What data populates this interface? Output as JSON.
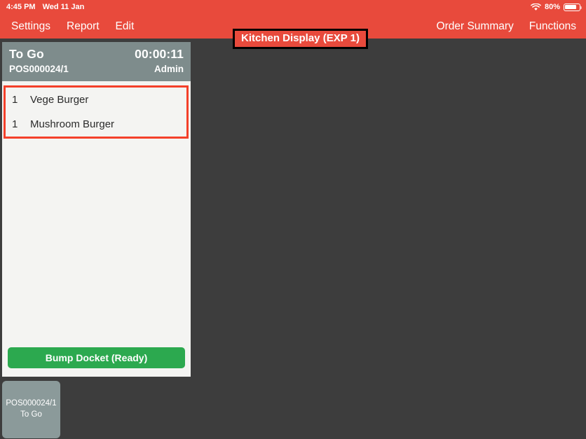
{
  "status_bar": {
    "time": "4:45 PM",
    "date": "Wed 11 Jan",
    "wifi_icon": "wifi-icon",
    "battery_percent": "80%",
    "battery_level": 80
  },
  "nav": {
    "title": "Kitchen Display (EXP 1)",
    "left_items": [
      {
        "label": "Settings",
        "name": "nav-item-settings"
      },
      {
        "label": "Report",
        "name": "nav-item-report"
      },
      {
        "label": "Edit",
        "name": "nav-item-edit"
      }
    ],
    "right_items": [
      {
        "label": "Order Summary",
        "name": "nav-item-order-summary"
      },
      {
        "label": "Functions",
        "name": "nav-item-functions"
      }
    ]
  },
  "docket": {
    "order_type": "To Go",
    "timer": "00:00:11",
    "reference": "POS000024/1",
    "user": "Admin",
    "items": [
      {
        "qty": "1",
        "name": "Vege Burger"
      },
      {
        "qty": "1",
        "name": "Mushroom Burger"
      }
    ],
    "bump_button_label": "Bump Docket (Ready)"
  },
  "order_tiles": [
    {
      "reference": "POS000024/1",
      "order_type": "To Go"
    }
  ],
  "colors": {
    "header_red": "#e84a3c",
    "background_dark": "#3d3d3d",
    "docket_header_gray": "#7e8c8c",
    "docket_body": "#f4f4f2",
    "bump_green": "#2ca94f",
    "highlight_red": "#f4402a",
    "highlight_black": "#000000",
    "tile_gray": "#8b9a9a"
  }
}
